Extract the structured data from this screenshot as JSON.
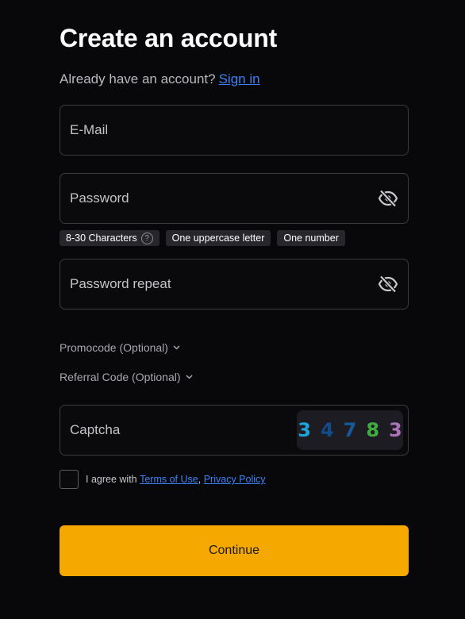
{
  "heading": "Create an account",
  "signin": {
    "prompt": "Already have an account?",
    "link": "Sign in"
  },
  "fields": {
    "email_placeholder": "E-Mail",
    "password_placeholder": "Password",
    "password_repeat_placeholder": "Password repeat",
    "captcha_placeholder": "Captcha"
  },
  "requirements": [
    {
      "label": "8-30 Characters",
      "help": "?"
    },
    {
      "label": "One uppercase letter"
    },
    {
      "label": "One number"
    }
  ],
  "optional": {
    "promocode": "Promocode (Optional)",
    "referral": "Referral Code (Optional)"
  },
  "captcha_digits": [
    {
      "char": "3",
      "color": "#1fa3d8"
    },
    {
      "char": "4",
      "color": "#134a8a"
    },
    {
      "char": "7",
      "color": "#165a9a"
    },
    {
      "char": "8",
      "color": "#3fae3f"
    },
    {
      "char": "3",
      "color": "#a974b8"
    }
  ],
  "agree": {
    "prefix": "I agree with",
    "terms": "Terms of Use",
    "separator": ",",
    "privacy": "Privacy Policy"
  },
  "submit_label": "Continue",
  "colors": {
    "background": "#08080b",
    "accent": "#f5a800",
    "link": "#3b82f6"
  }
}
